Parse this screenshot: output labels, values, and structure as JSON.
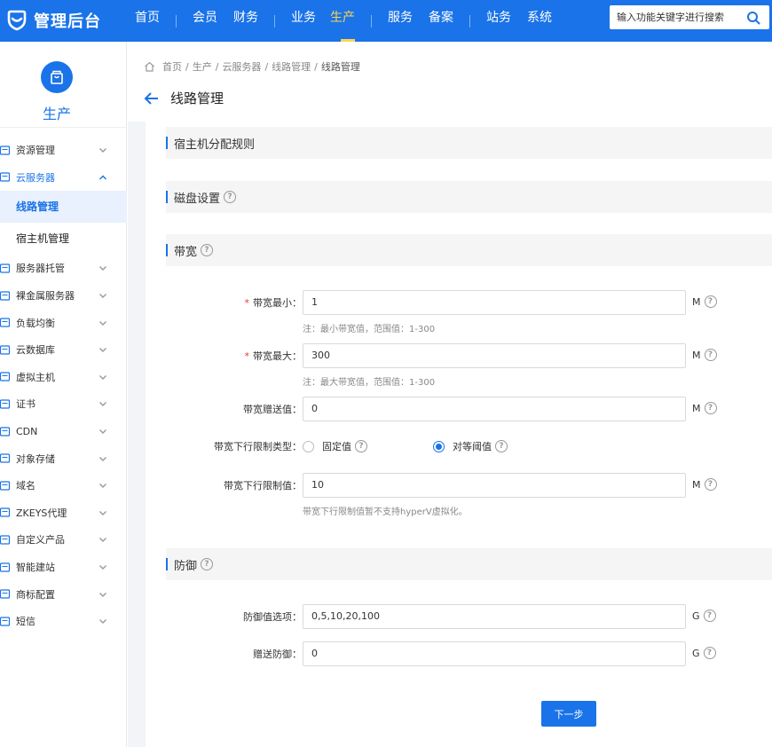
{
  "brand": {
    "name": "管理后台"
  },
  "nav": {
    "items": [
      "首页",
      "会员",
      "财务",
      "业务",
      "生产",
      "服务",
      "备案",
      "站务",
      "系统"
    ],
    "active_index": 4
  },
  "search": {
    "placeholder": "输入功能关键字进行搜索",
    "icon": "search-icon"
  },
  "sidebar": {
    "title": "生产",
    "menu": [
      {
        "label": "资源管理",
        "icon": "resource-icon",
        "open": false
      },
      {
        "label": "云服务器",
        "icon": "cloud-server-icon",
        "open": true,
        "children": [
          "线路管理",
          "宿主机管理"
        ],
        "active_child": 0
      },
      {
        "label": "服务器托管",
        "icon": "server-hosting-icon",
        "open": false
      },
      {
        "label": "裸金属服务器",
        "icon": "bare-metal-icon",
        "open": false
      },
      {
        "label": "负载均衡",
        "icon": "load-balance-icon",
        "open": false
      },
      {
        "label": "云数据库",
        "icon": "database-icon",
        "open": false
      },
      {
        "label": "虚拟主机",
        "icon": "virtual-host-icon",
        "open": false
      },
      {
        "label": "证书",
        "icon": "certificate-icon",
        "open": false
      },
      {
        "label": "CDN",
        "icon": "cdn-icon",
        "open": false
      },
      {
        "label": "对象存储",
        "icon": "object-storage-icon",
        "open": false
      },
      {
        "label": "域名",
        "icon": "domain-icon",
        "open": false
      },
      {
        "label": "ZKEYS代理",
        "icon": "proxy-icon",
        "open": false
      },
      {
        "label": "自定义产品",
        "icon": "custom-product-icon",
        "open": false
      },
      {
        "label": "智能建站",
        "icon": "site-builder-icon",
        "open": false
      },
      {
        "label": "商标配置",
        "icon": "trademark-icon",
        "open": false
      },
      {
        "label": "短信",
        "icon": "sms-icon",
        "open": false
      }
    ]
  },
  "breadcrumb": [
    "首页",
    "生产",
    "云服务器",
    "线路管理",
    "线路管理"
  ],
  "page": {
    "title": "线路管理"
  },
  "sections": {
    "host_rule": "宿主机分配规则",
    "disk": "磁盘设置",
    "bandwidth": "带宽",
    "defense": "防御"
  },
  "form": {
    "bw_min": {
      "label": "带宽最小：",
      "value": "1",
      "unit": "M",
      "note": "注：最小带宽值，范围值：1-300",
      "required": true
    },
    "bw_max": {
      "label": "带宽最大：",
      "value": "300",
      "unit": "M",
      "note": "注：最大带宽值，范围值：1-300",
      "required": true
    },
    "bw_gift": {
      "label": "带宽赠送值：",
      "value": "0",
      "unit": "M"
    },
    "bw_limit_type": {
      "label": "带宽下行限制类型：",
      "options": [
        "固定值",
        "对等阈值"
      ],
      "selected": 1
    },
    "bw_limit_value": {
      "label": "带宽下行限制值：",
      "value": "10",
      "unit": "M",
      "note": "带宽下行限制值暂不支持hyperV虚拟化。"
    },
    "defense_options": {
      "label": "防御值选项：",
      "value": "0,5,10,20,100",
      "unit": "G"
    },
    "defense_gift": {
      "label": "赠送防御：",
      "value": "0",
      "unit": "G"
    }
  },
  "buttons": {
    "next": "下一步"
  },
  "colors": {
    "primary": "#1a73e8",
    "nav_active": "#ffd54f",
    "required": "#e53935"
  }
}
